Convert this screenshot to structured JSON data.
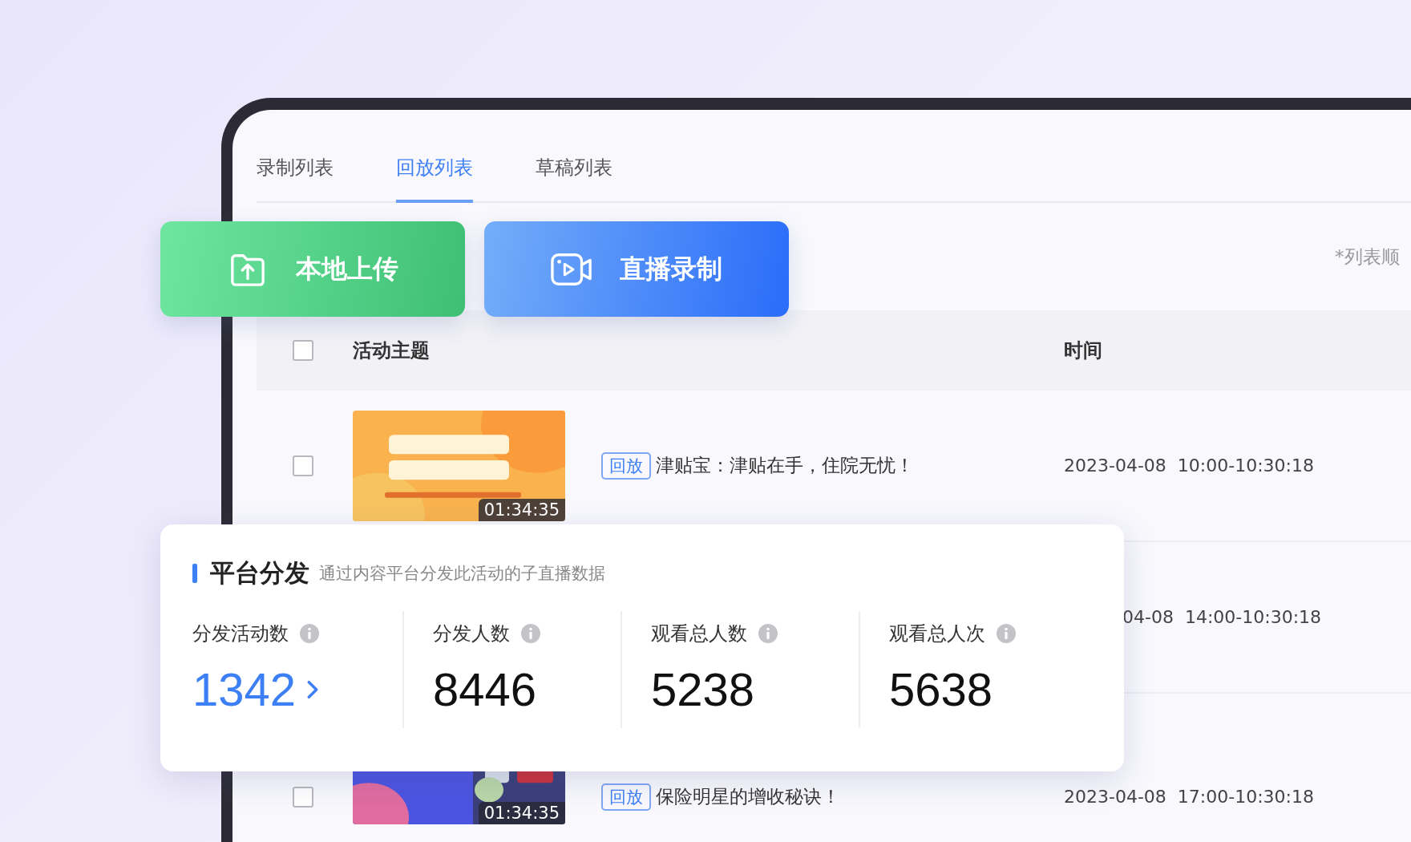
{
  "tabs": [
    {
      "label": "录制列表",
      "selected": false
    },
    {
      "label": "回放列表",
      "selected": true
    },
    {
      "label": "草稿列表",
      "selected": false
    }
  ],
  "actions": [
    {
      "label": "本地上传",
      "kind": "upload"
    },
    {
      "label": "直播录制",
      "kind": "record"
    }
  ],
  "list_note": "*列表顺",
  "table": {
    "columns": [
      "活动主题",
      "时间"
    ],
    "header_checked": false,
    "rows": [
      {
        "checked": false,
        "thumbnail": {
          "kind": "picture",
          "duration": "01:34:35"
        },
        "tag": "回放",
        "title": "津贴宝：津贴在手，住院无忧！",
        "time": "2023-04-08  10:00-10:30:18"
      },
      {
        "time": "04-08  14:00-10:30:18"
      },
      {
        "checked": false,
        "thumbnail": {
          "kind": "picture",
          "duration": "01:34:35"
        },
        "tag": "回放",
        "title": "保险明星的增收秘诀！",
        "time": "2023-04-08  17:00-10:30:18"
      }
    ]
  },
  "distribution_card": {
    "title": "平台分发",
    "subtitle": "通过内容平台分发此活动的子直播数据",
    "stats": [
      {
        "label": "分发活动数",
        "value": "1342",
        "link": true
      },
      {
        "label": "分发人数",
        "value": "8446",
        "link": false
      },
      {
        "label": "观看总人数",
        "value": "5238",
        "link": false
      },
      {
        "label": "观看总人次",
        "value": "5638",
        "link": false
      }
    ]
  }
}
